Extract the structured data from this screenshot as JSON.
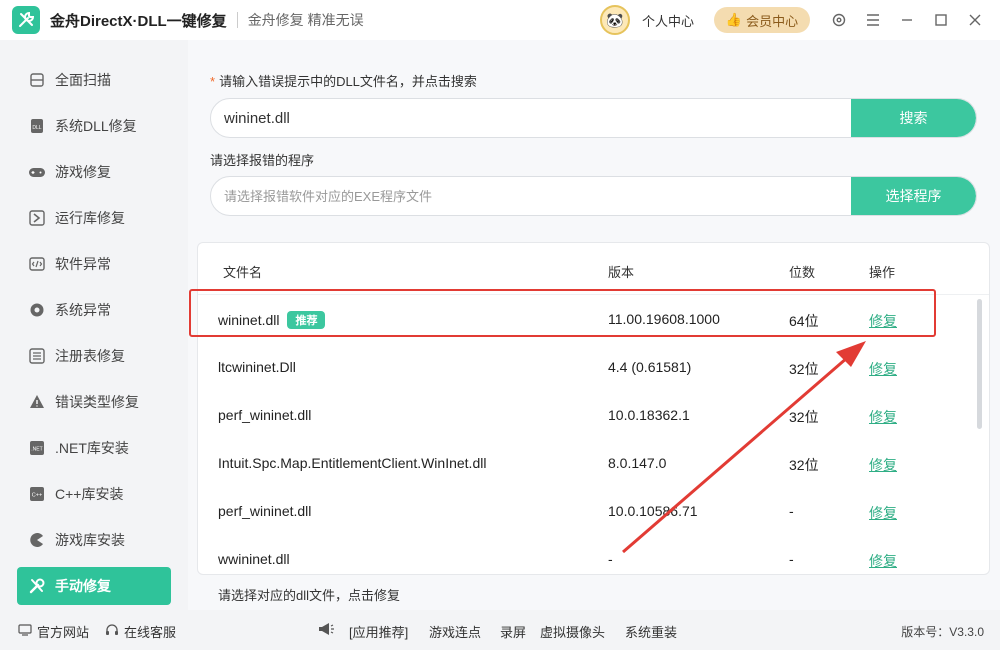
{
  "titlebar": {
    "title": "金舟DirectX·DLL一键修复",
    "subtitle": "金舟修复 精准无误",
    "user_center": "个人中心",
    "vip": "会员中心"
  },
  "sidebar": {
    "items": [
      {
        "label": "全面扫描",
        "icon": "scan-icon"
      },
      {
        "label": "系统DLL修复",
        "icon": "dll-icon"
      },
      {
        "label": "游戏修复",
        "icon": "gamepad-icon"
      },
      {
        "label": "运行库修复",
        "icon": "runtime-icon"
      },
      {
        "label": "软件异常",
        "icon": "code-icon"
      },
      {
        "label": "系统异常",
        "icon": "gear-icon"
      },
      {
        "label": "注册表修复",
        "icon": "list-icon"
      },
      {
        "label": "错误类型修复",
        "icon": "warning-icon"
      },
      {
        "label": ".NET库安装",
        "icon": "dotnet-icon"
      },
      {
        "label": "C++库安装",
        "icon": "cpp-icon"
      },
      {
        "label": "游戏库安装",
        "icon": "pacman-icon"
      },
      {
        "label": "手动修复",
        "icon": "wrench-icon",
        "active": true
      }
    ]
  },
  "search": {
    "label": "请输入错误提示中的DLL文件名，并点击搜索",
    "value": "wininet.dll",
    "button": "搜索"
  },
  "program": {
    "label": "请选择报错的程序",
    "placeholder": "请选择报错软件对应的EXE程序文件",
    "button": "选择程序"
  },
  "table": {
    "headers": {
      "filename": "文件名",
      "version": "版本",
      "bits": "位数",
      "action": "操作"
    },
    "recommend_badge": "推荐",
    "rows": [
      {
        "filename": "wininet.dll",
        "version": "11.00.19608.1000",
        "bits": "64位",
        "action": "修复",
        "recommended": true
      },
      {
        "filename": "ltcwininet.Dll",
        "version": "4.4 (0.61581)",
        "bits": "32位",
        "action": "修复"
      },
      {
        "filename": "perf_wininet.dll",
        "version": "10.0.18362.1",
        "bits": "32位",
        "action": "修复"
      },
      {
        "filename": "Intuit.Spc.Map.EntitlementClient.WinInet.dll",
        "version": "8.0.147.0",
        "bits": "32位",
        "action": "修复"
      },
      {
        "filename": "perf_wininet.dll",
        "version": "10.0.10586.71",
        "bits": "-",
        "action": "修复"
      },
      {
        "filename": "wwininet.dll",
        "version": "-",
        "bits": "-",
        "action": "修复"
      }
    ]
  },
  "hint": "请选择对应的dll文件，点击修复",
  "footer": {
    "website": "官方网站",
    "service": "在线客服",
    "links": [
      "[应用推荐]",
      "游戏连点",
      "录屏",
      "虚拟摄像头",
      "系统重装"
    ],
    "version": "版本号：V3.3.0"
  },
  "colors": {
    "accent": "#2fc39a",
    "highlight": "#e23b34",
    "link": "#2fae85"
  }
}
